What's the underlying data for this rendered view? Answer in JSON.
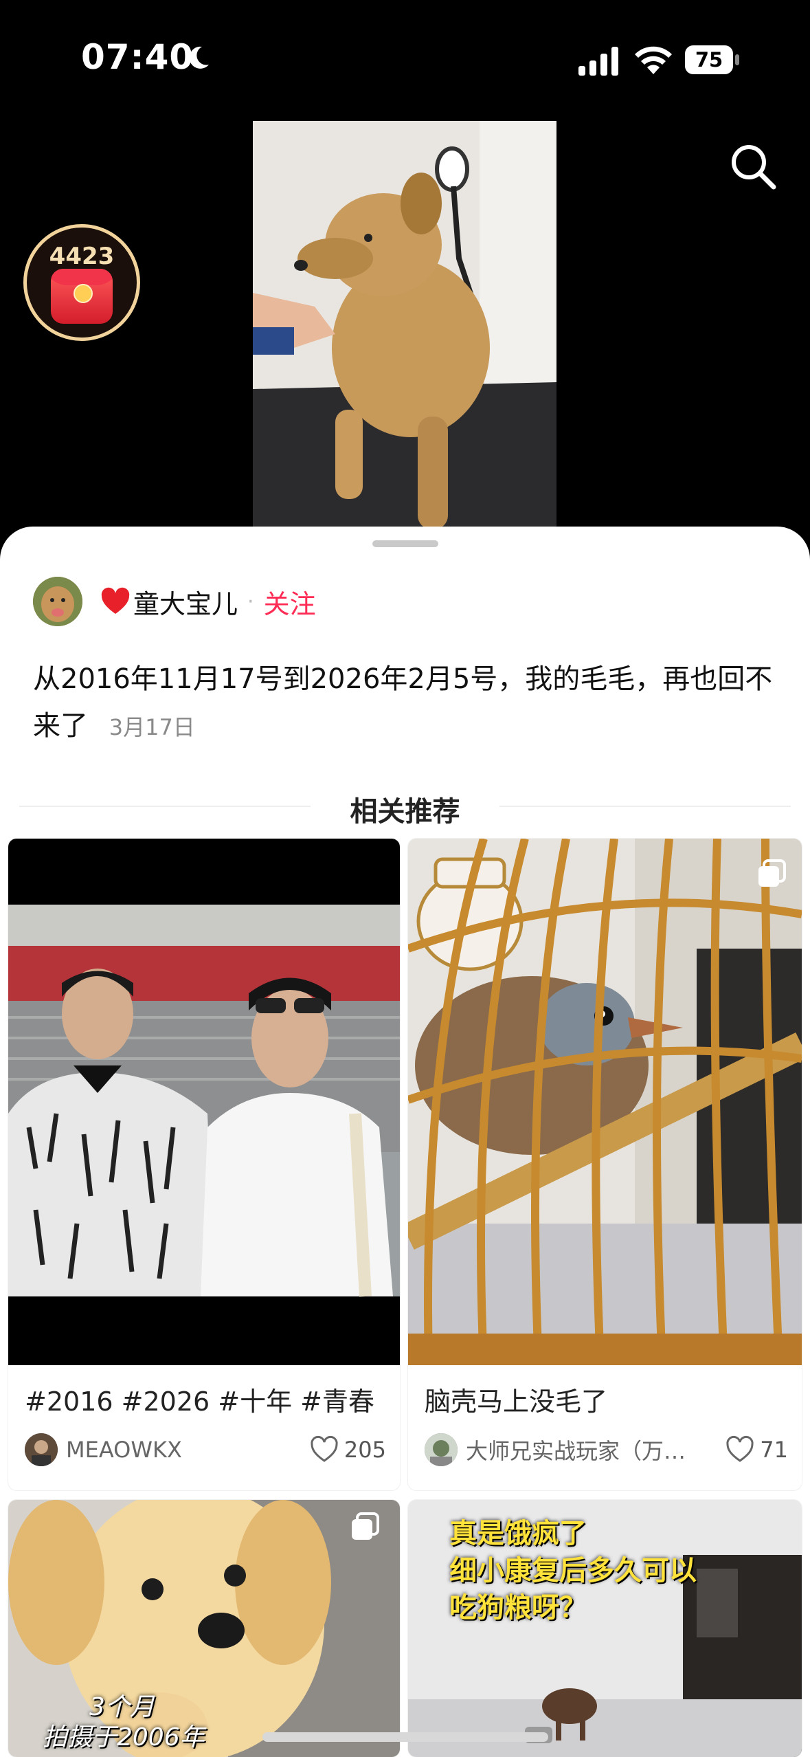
{
  "status_bar": {
    "time": "07:40",
    "battery": "75"
  },
  "red_packet": {
    "count": "4423"
  },
  "post": {
    "author": "童大宝儿",
    "follow_label": "关注",
    "description": "从2016年11月17号到2026年2月5号，我的毛毛，再也回不来了",
    "date": "3月17日"
  },
  "related": {
    "title": "相关推荐",
    "cards": [
      {
        "title": "#2016 #2026 #十年 #青春",
        "author": "MEAOWKX",
        "likes": "205"
      },
      {
        "title": "脑壳马上没毛了",
        "author": "大师兄实战玩家（万…",
        "likes": "71"
      },
      {
        "overlay_line1": "3个月",
        "overlay_line2": "拍摄于2006年"
      },
      {
        "overlay_line1": "真是饿疯了",
        "overlay_line2": "细小康复后多久可以",
        "overlay_line3": "吃狗粮呀？"
      }
    ]
  },
  "colors": {
    "accent": "#fe2c55",
    "heart": "#e8202a"
  },
  "icons": [
    "moon-icon",
    "signal-icon",
    "wifi-icon",
    "battery-icon",
    "search-icon",
    "red-envelope-icon",
    "heart-emoji-icon",
    "like-heart-icon",
    "multi-image-icon"
  ]
}
